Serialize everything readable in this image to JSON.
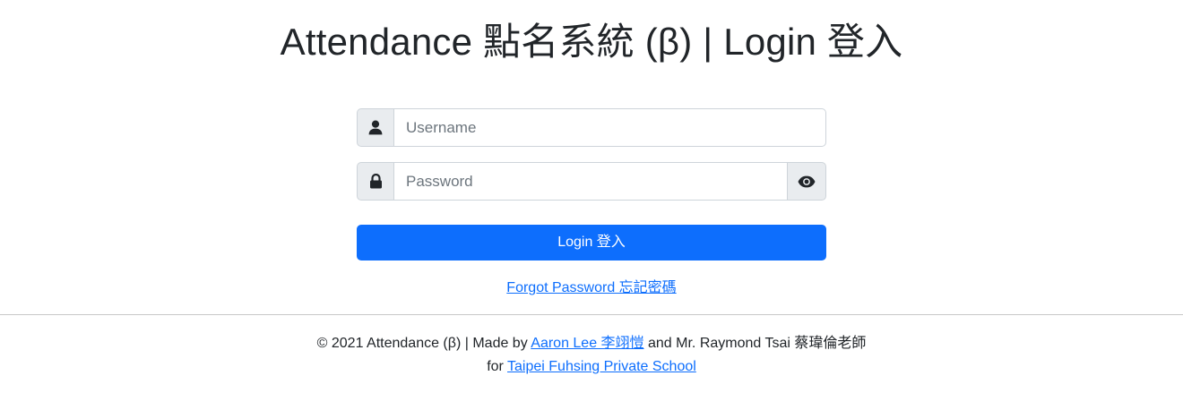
{
  "page": {
    "title": "Attendance 點名系統 (β) | Login 登入"
  },
  "login_form": {
    "username_placeholder": "Username",
    "username_value": "",
    "username_icon": "user-icon",
    "password_placeholder": "Password",
    "password_value": "",
    "password_icon": "lock-icon",
    "toggle_icon": "eye-icon",
    "login_label": "Login 登入",
    "forgot_label": "Forgot Password 忘記密碼"
  },
  "footer": {
    "line1_prefix": "© 2021 Attendance (β) | Made by ",
    "author_link": "Aaron Lee 李翊愷",
    "line1_suffix": " and Mr. Raymond Tsai 蔡瑋倫老師",
    "line2_prefix": "for ",
    "school_link": "Taipei Fuhsing Private School"
  },
  "colors": {
    "primary": "#0d6efd",
    "addon_bg": "#e9ecef",
    "border": "#ced4da",
    "text": "#212529"
  }
}
